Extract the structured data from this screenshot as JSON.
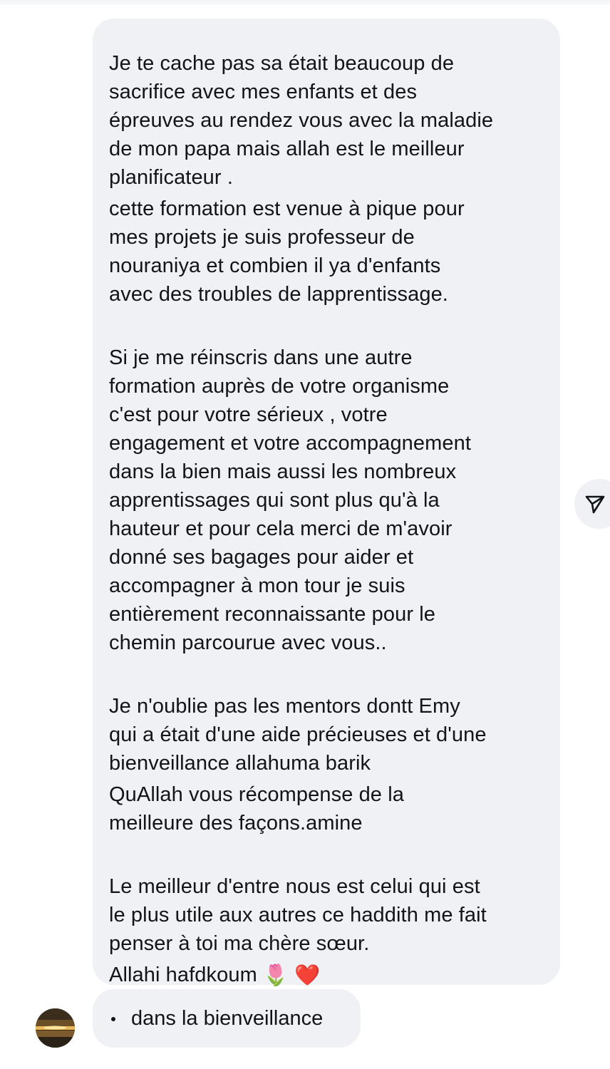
{
  "messages": {
    "main": {
      "p1": "Je te cache pas sa était beaucoup de\nsacrifice avec mes enfants et des\népreuves au rendez vous avec la maladie\nde mon papa mais allah est le meilleur\nplanificateur .",
      "p2": "cette formation est venue à pique pour\nmes projets je suis professeur de\nnouraniya et combien il ya d'enfants\navec des troubles  de lapprentissage.",
      "p3": "Si je me réinscris dans une autre\nformation auprès de votre organisme\nc'est pour votre sérieux , votre\nengagement  et votre accompagnement\ndans la bien mais aussi les nombreux\napprentissages qui sont  plus qu'à la\nhauteur et pour cela merci de m'avoir\ndonné ses bagages pour aider et\naccompagner à mon tour je suis\nentièrement reconnaissante pour le\nchemin parcourue avec vous..",
      "p4": "Je n'oublie pas les mentors dontt Emy\nqui a était d'une aide précieuses et d'une\nbienveillance allahuma barik",
      "p5": "QuAllah vous récompense de la\nmeilleure des façons.amine",
      "p6": "Le meilleur d'entre nous est celui qui est\nle plus utile aux autres ce haddith me fait\npenser à toi ma chère sœur.",
      "p7_text": "Allahi hafdkoum",
      "p7_emojis": [
        "🌷",
        "❤️"
      ]
    },
    "second": {
      "text": "dans la bienveillance"
    }
  },
  "icons": {
    "send": "send-icon",
    "avatar": "avatar"
  },
  "colors": {
    "bubble": "#eff1f4",
    "text": "#111418",
    "background": "#ffffff"
  }
}
